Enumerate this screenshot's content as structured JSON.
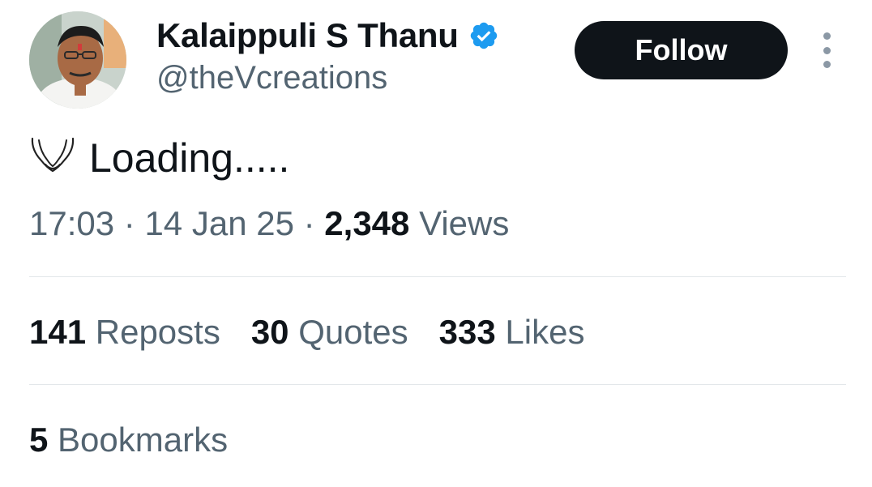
{
  "author": {
    "display_name": "Kalaippuli S Thanu",
    "handle": "@theVcreations",
    "verified_icon": "verified-badge-icon",
    "verified_color": "#1d9bf0"
  },
  "follow_button": {
    "label": "Follow"
  },
  "more_menu": {
    "icon": "more-vertical-icon"
  },
  "tweet": {
    "emoji_icon": "ox-horns-emoji-icon",
    "text": "Loading....."
  },
  "meta": {
    "time": "17:03",
    "separator": "·",
    "date": "14 Jan 25",
    "views_count": "2,348",
    "views_label": "Views"
  },
  "stats": {
    "reposts_count": "141",
    "reposts_label": "Reposts",
    "quotes_count": "30",
    "quotes_label": "Quotes",
    "likes_count": "333",
    "likes_label": "Likes",
    "bookmarks_count": "5",
    "bookmarks_label": "Bookmarks"
  },
  "colors": {
    "text_primary": "#0f1419",
    "text_secondary": "#536471",
    "divider": "#e3e7ea",
    "button_bg": "#0f1419",
    "button_text": "#ffffff"
  }
}
